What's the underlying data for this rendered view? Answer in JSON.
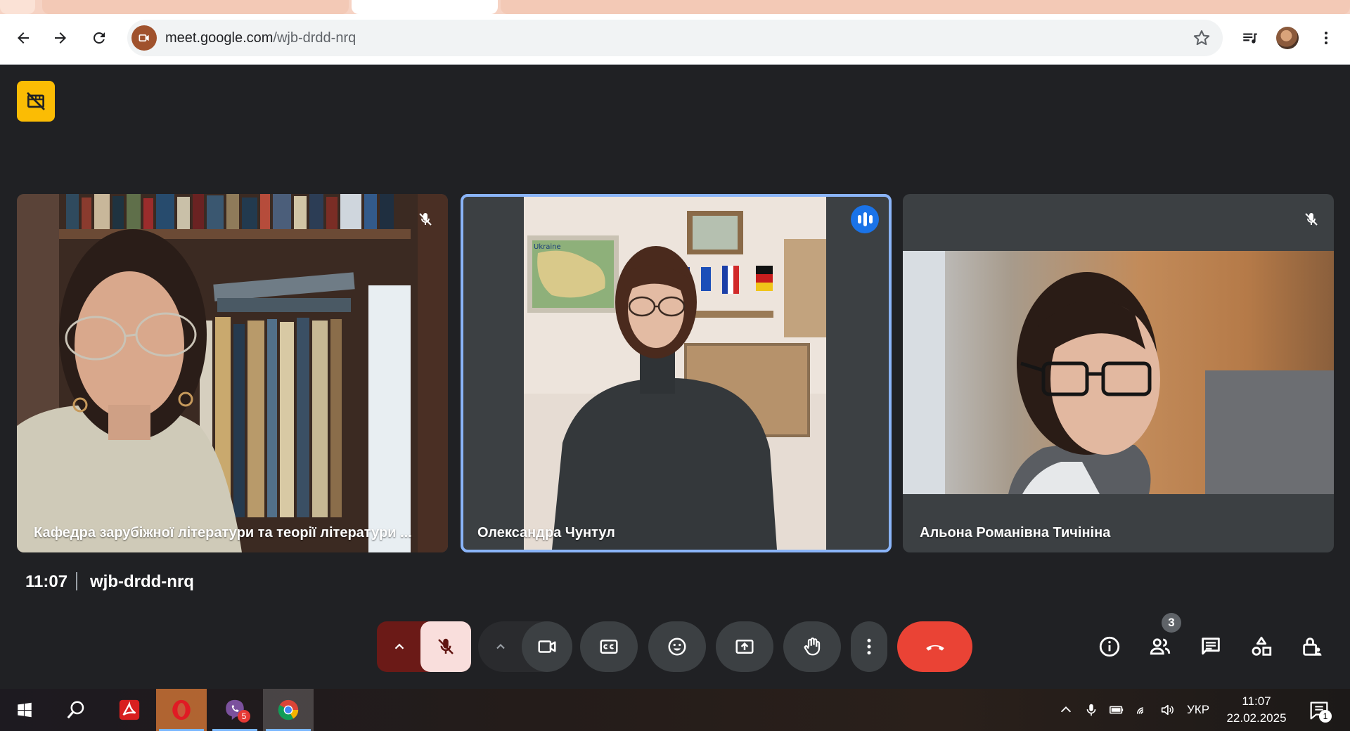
{
  "browser": {
    "url_host": "meet.google.com",
    "url_path": "/wjb-drdd-nrq"
  },
  "participants": [
    {
      "name": "Кафедра зарубіжної літератури та теорії літератури ...",
      "muted": true,
      "speaking": false
    },
    {
      "name": "Олександра Чунтул",
      "muted": false,
      "speaking": true
    },
    {
      "name": "Альона Романівна Тичініна",
      "muted": true,
      "speaking": false
    }
  ],
  "meeting": {
    "time": "11:07",
    "code": "wjb-drdd-nrq",
    "participant_count": "3"
  },
  "controls": {
    "mic": "mic-off",
    "camera": "camera",
    "captions": "captions",
    "reactions": "emoji",
    "present": "present-screen",
    "raise_hand": "hand",
    "more": "more-options",
    "hangup": "leave-call"
  },
  "colors": {
    "meet_bg": "#202124",
    "tile_bg": "#3c4043",
    "active_border": "#8ab4f8",
    "hangup_red": "#ea4335",
    "mic_off_bg": "#f9dedc",
    "badge_yellow": "#fbbc04"
  },
  "taskbar": {
    "apps": [
      "windows-start",
      "search",
      "adobe-acrobat",
      "opera",
      "viber",
      "chrome"
    ],
    "viber_badge": "5",
    "language": "УКР",
    "clock_time": "11:07",
    "clock_date": "22.02.2025",
    "notification_count": "1"
  }
}
